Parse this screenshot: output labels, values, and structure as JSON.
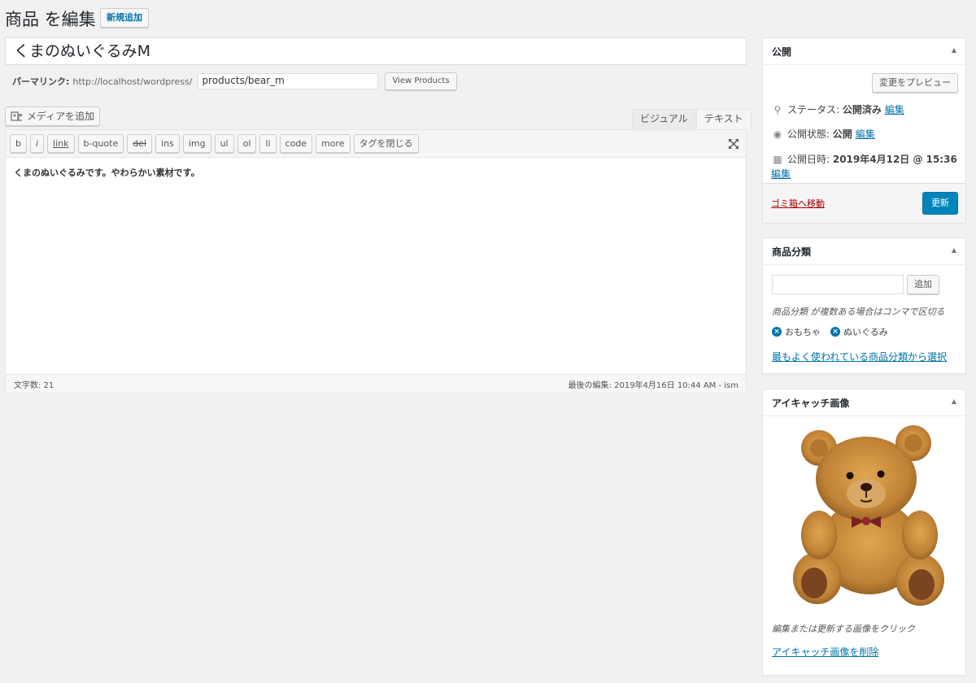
{
  "header": {
    "title": "商品 を編集",
    "add_new": "新規追加"
  },
  "post": {
    "title": "くまのぬいぐるみM"
  },
  "permalink": {
    "label": "パーマリンク:",
    "base_url": "http://localhost/wordpress/",
    "slug": "products/bear_m",
    "view_button": "View Products"
  },
  "media": {
    "add_media": "メディアを追加"
  },
  "editor": {
    "tabs": {
      "visual": "ビジュアル",
      "text": "テキスト"
    },
    "quicktags": [
      "b",
      "i",
      "link",
      "b-quote",
      "del",
      "ins",
      "img",
      "ul",
      "ol",
      "li",
      "code",
      "more",
      "タグを閉じる"
    ],
    "content": "くまのぬいぐるみです。やわらかい素材です。",
    "word_count": "文字数: 21",
    "last_edit": "最後の編集: 2019年4月16日 10:44 AM - ism"
  },
  "publish": {
    "title": "公開",
    "preview": "変更をプレビュー",
    "status_label": "ステータス: ",
    "status_value": "公開済み",
    "visibility_label": "公開状態: ",
    "visibility_value": "公開",
    "date_label": "公開日時: ",
    "date_value": "2019年4月12日 @ 15:36",
    "edit": "編集",
    "trash": "ゴミ箱へ移動",
    "update": "更新"
  },
  "category": {
    "title": "商品分類",
    "add": "追加",
    "hint": "商品分類 が複数ある場合はコンマで区切る",
    "tags": [
      "おもちゃ",
      "ぬいぐるみ"
    ],
    "most_used": "最もよく使われている商品分類から選択"
  },
  "thumbnail": {
    "title": "アイキャッチ画像",
    "hint": "編集または更新する画像をクリック",
    "remove": "アイキャッチ画像を削除"
  },
  "colors": {
    "primary": "#0085ba",
    "link": "#0073aa",
    "danger": "#a00",
    "background": "#f1f1f1"
  },
  "icons": [
    "pin-icon",
    "eye-icon",
    "calendar-icon",
    "media-icon",
    "fullscreen-icon",
    "remove-tag-icon",
    "collapse-arrow-icon"
  ]
}
